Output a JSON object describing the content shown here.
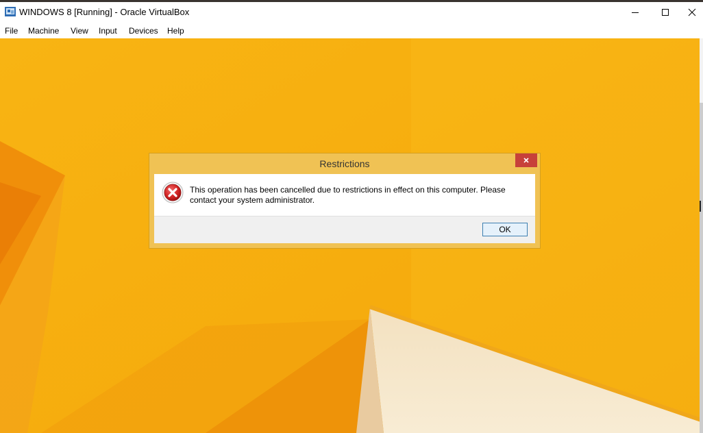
{
  "window": {
    "title": "WINDOWS 8 [Running] - Oracle VirtualBox",
    "app_icon": "virtualbox-icon",
    "controls": {
      "minimize": "minimize-icon",
      "maximize": "maximize-icon",
      "close": "close-icon"
    }
  },
  "menu": {
    "items": [
      {
        "label": "File"
      },
      {
        "label": "Machine"
      },
      {
        "label": "View"
      },
      {
        "label": "Input"
      },
      {
        "label": "Devices"
      },
      {
        "label": "Help"
      }
    ]
  },
  "desktop": {
    "background_color": "#f7b20d"
  },
  "dialog": {
    "title": "Restrictions",
    "message": "This operation has been cancelled due to restrictions in effect on this computer. Please contact your system administrator.",
    "icon": "error-icon",
    "ok_label": "OK",
    "close_icon": "close-icon",
    "frame_color": "#f0c254",
    "close_color": "#c7413a"
  }
}
